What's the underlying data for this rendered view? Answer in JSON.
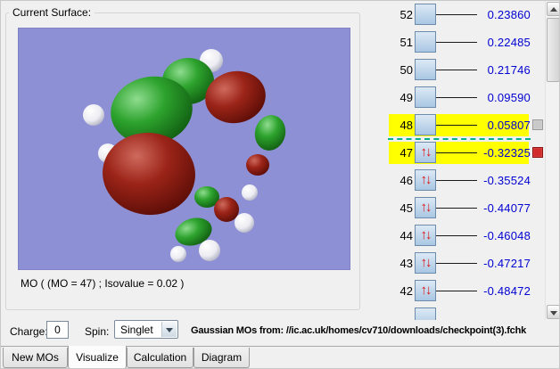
{
  "surface_panel": {
    "title": "Current Surface:",
    "caption": "MO ( (MO = 47) ; Isovalue = 0.02 )"
  },
  "controls": {
    "charge_label": "Charge:",
    "charge_value": "0",
    "spin_label": "Spin:",
    "spin_value": "Singlet",
    "source_label": "Gaussian MOs from:",
    "source_path": "//ic.ac.uk/homes/cv710/downloads/checkpoint(3).fchk"
  },
  "tabs": [
    {
      "label": "New MOs",
      "active": false
    },
    {
      "label": "Visualize",
      "active": true
    },
    {
      "label": "Calculation",
      "active": false
    },
    {
      "label": "Diagram",
      "active": false
    }
  ],
  "icons": {
    "occupied_arrows": "↑↓"
  },
  "mo_list": {
    "divider_after_index": 4,
    "rows": [
      {
        "number": "52",
        "energy": "0.23860",
        "occupied": false,
        "highlighted": false,
        "checkbox": ""
      },
      {
        "number": "51",
        "energy": "0.22485",
        "occupied": false,
        "highlighted": false,
        "checkbox": ""
      },
      {
        "number": "50",
        "energy": "0.21746",
        "occupied": false,
        "highlighted": false,
        "checkbox": ""
      },
      {
        "number": "49",
        "energy": "0.09590",
        "occupied": false,
        "highlighted": false,
        "checkbox": ""
      },
      {
        "number": "48",
        "energy": "0.05807",
        "occupied": false,
        "highlighted": true,
        "checkbox": "gray"
      },
      {
        "number": "47",
        "energy": "-0.32325",
        "occupied": true,
        "highlighted": true,
        "checkbox": "red"
      },
      {
        "number": "46",
        "energy": "-0.35524",
        "occupied": true,
        "highlighted": false,
        "checkbox": ""
      },
      {
        "number": "45",
        "energy": "-0.44077",
        "occupied": true,
        "highlighted": false,
        "checkbox": ""
      },
      {
        "number": "44",
        "energy": "-0.46048",
        "occupied": true,
        "highlighted": false,
        "checkbox": ""
      },
      {
        "number": "43",
        "energy": "-0.47217",
        "occupied": true,
        "highlighted": false,
        "checkbox": ""
      },
      {
        "number": "42",
        "energy": "-0.48472",
        "occupied": true,
        "highlighted": false,
        "checkbox": ""
      },
      {
        "number": "",
        "energy": "",
        "occupied": false,
        "highlighted": false,
        "checkbox": ""
      }
    ]
  },
  "colors": {
    "highlight_yellow": "#ffff00",
    "energy_blue": "#0000d2",
    "viewport_purple": "#8e90d6",
    "divider_teal": "#00b08d",
    "selected_checkbox_red": "#d22b2b",
    "lumo_checkbox_gray": "#c9c9c9"
  }
}
